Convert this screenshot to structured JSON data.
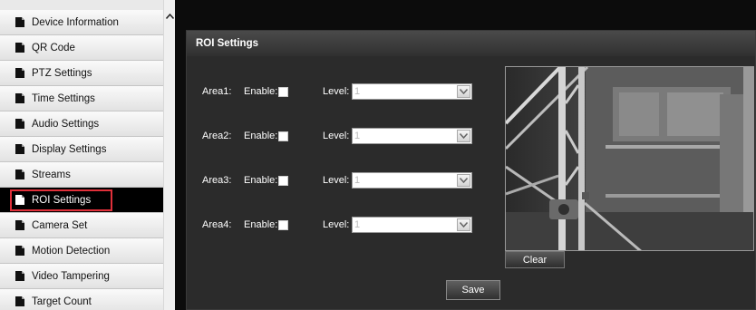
{
  "sidebar": {
    "items": [
      {
        "label": "Device Information"
      },
      {
        "label": "QR Code"
      },
      {
        "label": "PTZ Settings"
      },
      {
        "label": "Time Settings"
      },
      {
        "label": "Audio Settings"
      },
      {
        "label": "Display Settings"
      },
      {
        "label": "Streams"
      },
      {
        "label": "ROI Settings"
      },
      {
        "label": "Camera Set"
      },
      {
        "label": "Motion Detection"
      },
      {
        "label": "Video Tampering"
      },
      {
        "label": "Target Count"
      }
    ],
    "active_item": "ROI Settings",
    "icon": "document-icon"
  },
  "panel": {
    "title": "ROI Settings",
    "areas": [
      {
        "label": "Area1:",
        "enable_label": "Enable:",
        "enabled": false,
        "level_label": "Level:",
        "level_value": "1"
      },
      {
        "label": "Area2:",
        "enable_label": "Enable:",
        "enabled": false,
        "level_label": "Level:",
        "level_value": "1"
      },
      {
        "label": "Area3:",
        "enable_label": "Enable:",
        "enabled": false,
        "level_label": "Level:",
        "level_value": "1"
      },
      {
        "label": "Area4:",
        "enable_label": "Enable:",
        "enabled": false,
        "level_label": "Level:",
        "level_value": "1"
      }
    ],
    "clear_label": "Clear",
    "save_label": "Save"
  },
  "colors": {
    "highlight": "#e0303a",
    "panel_bg": "#2b2b2b",
    "active_nav_bg": "#000000"
  }
}
